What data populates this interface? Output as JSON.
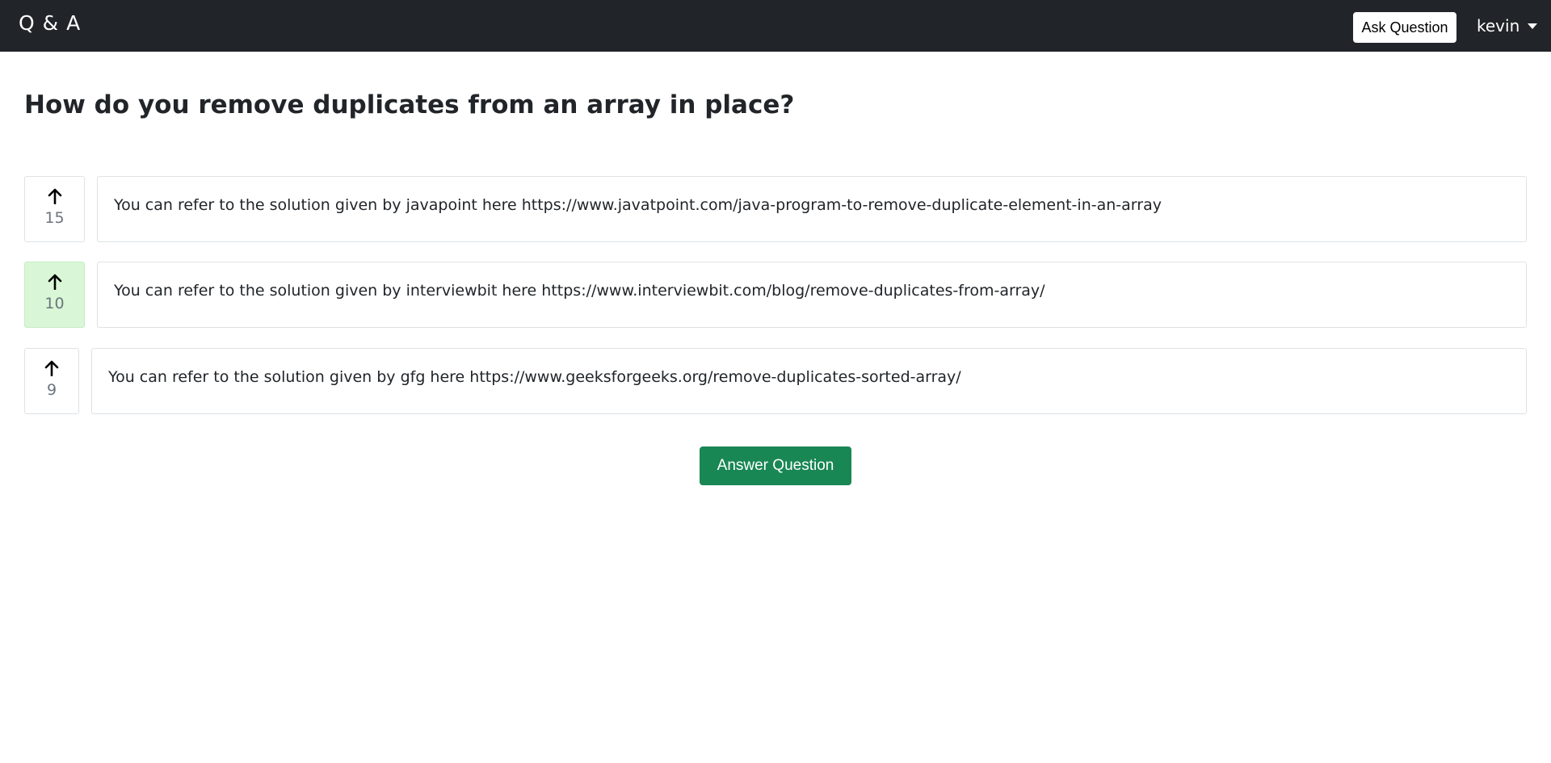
{
  "navbar": {
    "brand": "Q & A",
    "ask_button": "Ask Question",
    "user": "kevin"
  },
  "question": {
    "title": "How do you remove duplicates from an array in place?"
  },
  "answers": [
    {
      "votes": "15",
      "upvoted": false,
      "text": "You can refer to the solution given by javapoint here https://www.javatpoint.com/java-program-to-remove-duplicate-element-in-an-array"
    },
    {
      "votes": "10",
      "upvoted": true,
      "text": "You can refer to the solution given by interviewbit here https://www.interviewbit.com/blog/remove-duplicates-from-array/"
    },
    {
      "votes": "9",
      "upvoted": false,
      "text": "You can refer to the solution given by gfg here https://www.geeksforgeeks.org/remove-duplicates-sorted-array/"
    }
  ],
  "actions": {
    "answer_button": "Answer Question"
  },
  "icons": {
    "upvote": "arrow-up-icon",
    "user_menu": "caret-down-icon"
  },
  "colors": {
    "navbar": "#212529",
    "upvoted_bg": "#d9f7d7",
    "answer_button": "#198754"
  }
}
